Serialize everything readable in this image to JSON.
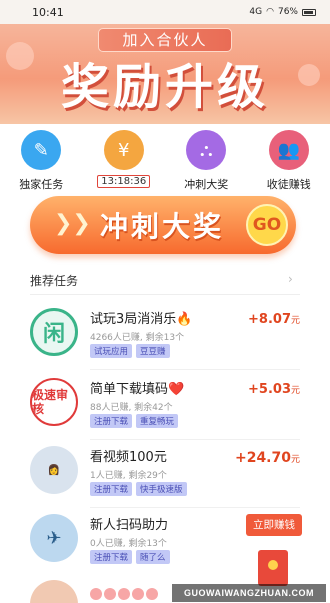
{
  "status_bar": {
    "time": "10:41",
    "signal": "4G",
    "battery": "76%"
  },
  "hero": {
    "pill_text": "加入合伙人",
    "headline": "奖励升级"
  },
  "quick_icons": [
    {
      "label": "独家任务",
      "icon": "edit-icon",
      "glyph": "✎"
    },
    {
      "label": "13:18:36",
      "icon": "yen-icon",
      "glyph": "¥"
    },
    {
      "label": "冲刺大奖",
      "icon": "hierarchy-icon",
      "glyph": "⛬"
    },
    {
      "label": "收徒赚钱",
      "icon": "users-icon",
      "glyph": "👥"
    }
  ],
  "sprint_banner": {
    "arrows": "❯❯",
    "text": "冲刺大奖",
    "go": "GO"
  },
  "section": {
    "title": "推荐任务",
    "chevron": "›"
  },
  "tasks": [
    {
      "title": "试玩3局消消乐🔥",
      "meta": "4266人已赚, 剩余13个",
      "tags": [
        "试玩应用",
        "豆豆赚"
      ],
      "reward": "+8.07",
      "unit": "元",
      "avatar_text": "闲"
    },
    {
      "title": "简单下载填码❤️",
      "meta": "88人已赚, 剩余42个",
      "tags": [
        "注册下载",
        "重复畅玩"
      ],
      "reward": "+5.03",
      "unit": "元",
      "avatar_text": "极速审核"
    },
    {
      "title": "看视频100元",
      "meta": "1人已赚, 剩余29个",
      "tags": [
        "注册下载",
        "快手极速版"
      ],
      "reward": "+24.70",
      "unit": "元",
      "avatar_text": ""
    },
    {
      "title": "新人扫码助力",
      "meta": "0人已赚, 剩余13个",
      "tags": [
        "注册下载",
        "随了么"
      ],
      "reward": "",
      "unit": "",
      "avatar_text": ""
    }
  ],
  "claim_button": "立即赚钱",
  "watermark": "GUOWAIWANGZHUAN.COM"
}
